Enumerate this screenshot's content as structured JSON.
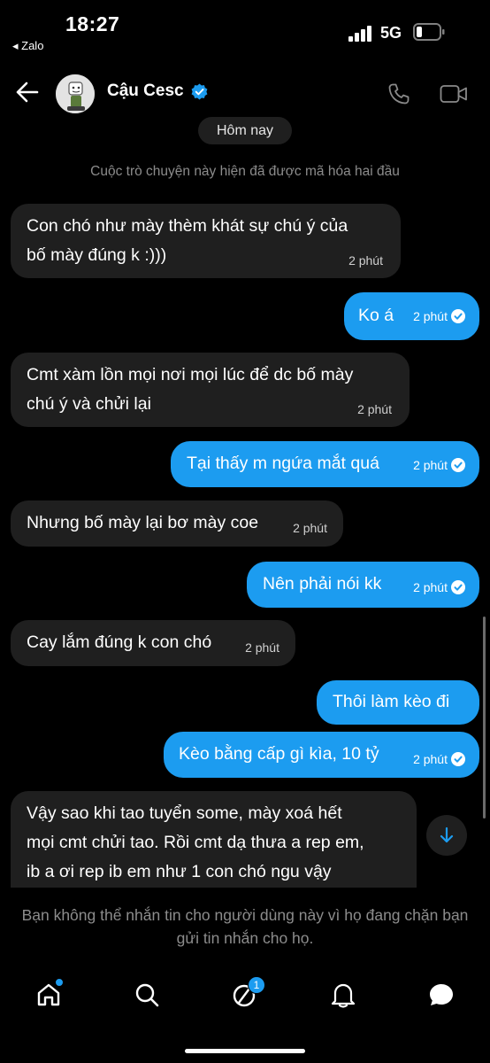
{
  "status_bar": {
    "time": "18:27",
    "back_app": "◂ Zalo",
    "network": "5G"
  },
  "header": {
    "contact_name": "Cậu Cesc",
    "verified": true
  },
  "chat": {
    "date_label": "Hôm nay",
    "encryption_notice": "Cuộc trò chuyện này hiện đã được mã hóa hai đầu",
    "messages": [
      {
        "direction": "in",
        "lines": [
          "Con chó như mày thèm khát sự chú ý của",
          "bố mày đúng k :)))"
        ],
        "time": "2 phút"
      },
      {
        "direction": "out",
        "text": "Ko á",
        "time": "2 phút",
        "read": true
      },
      {
        "direction": "in",
        "lines": [
          "Cmt xàm lồn mọi nơi mọi lúc để dc bố mày",
          "chú ý và chửi lại"
        ],
        "time": "2 phút"
      },
      {
        "direction": "out",
        "text": "Tại thấy m ngứa mắt quá",
        "time": "2 phút",
        "read": true
      },
      {
        "direction": "in",
        "text": "Nhưng bố mày lại bơ mày coe",
        "time": "2 phút"
      },
      {
        "direction": "out",
        "text": "Nên phải nói kk",
        "time": "2 phút",
        "read": true
      },
      {
        "direction": "in",
        "text": "Cay lắm đúng k con chó",
        "time": "2 phút"
      },
      {
        "direction": "out",
        "text": "Thôi làm kèo đi"
      },
      {
        "direction": "out",
        "text": "Kèo bằng cấp gì kìa, 10 tỷ",
        "time": "2 phút",
        "read": true
      },
      {
        "direction": "in",
        "lines": [
          "Vậy sao khi tao tuyển some, mày xoá hết",
          "mọi cmt chửi tao. Rồi cmt dạ thưa a rep em,",
          "ib a ơi rep ib em như 1 con chó ngu vậy"
        ]
      }
    ]
  },
  "blocked_notice": "Bạn không thể nhắn tin cho người dùng này vì họ đang chặn bạn gửi tin nhắn cho họ.",
  "bottom_nav": {
    "messages_badge": "1"
  },
  "colors": {
    "accent": "#1c9cf0",
    "incoming_bubble": "#1f1f1f",
    "background": "#000000"
  },
  "icons": [
    "back-arrow-icon",
    "verified-badge-icon",
    "phone-icon",
    "video-camera-icon",
    "read-check-icon",
    "arrow-down-icon",
    "home-icon",
    "search-icon",
    "explore-icon",
    "bell-icon",
    "messages-icon"
  ]
}
